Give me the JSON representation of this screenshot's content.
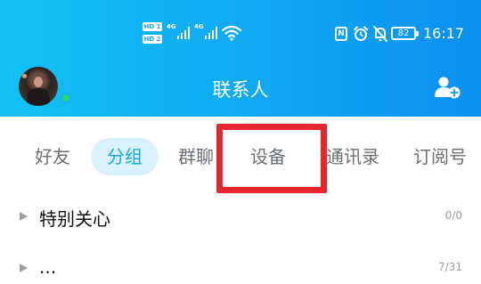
{
  "status_bar": {
    "sim1_badge": "HD 1",
    "sim2_badge": "HD 2",
    "network1": "4G",
    "network2": "4G",
    "nfc": "N",
    "battery": "82",
    "time": "16:17"
  },
  "title_bar": {
    "title": "联系人"
  },
  "tabs": [
    {
      "label": "好友",
      "active": false
    },
    {
      "label": "分组",
      "active": true
    },
    {
      "label": "群聊",
      "active": false
    },
    {
      "label": "设备",
      "active": false
    },
    {
      "label": "通讯录",
      "active": false
    },
    {
      "label": "订阅号",
      "active": false
    }
  ],
  "groups": [
    {
      "name": "特别关心",
      "count": "0/0"
    },
    {
      "name": "...",
      "count": "7/31"
    }
  ],
  "colors": {
    "header_start": "#12c2f3",
    "header_end": "#0c8ff1",
    "active_tab_bg": "#d8f1fb",
    "active_tab_text": "#13a9e8",
    "highlight_border": "#e8262f",
    "online": "#2fd07c"
  }
}
